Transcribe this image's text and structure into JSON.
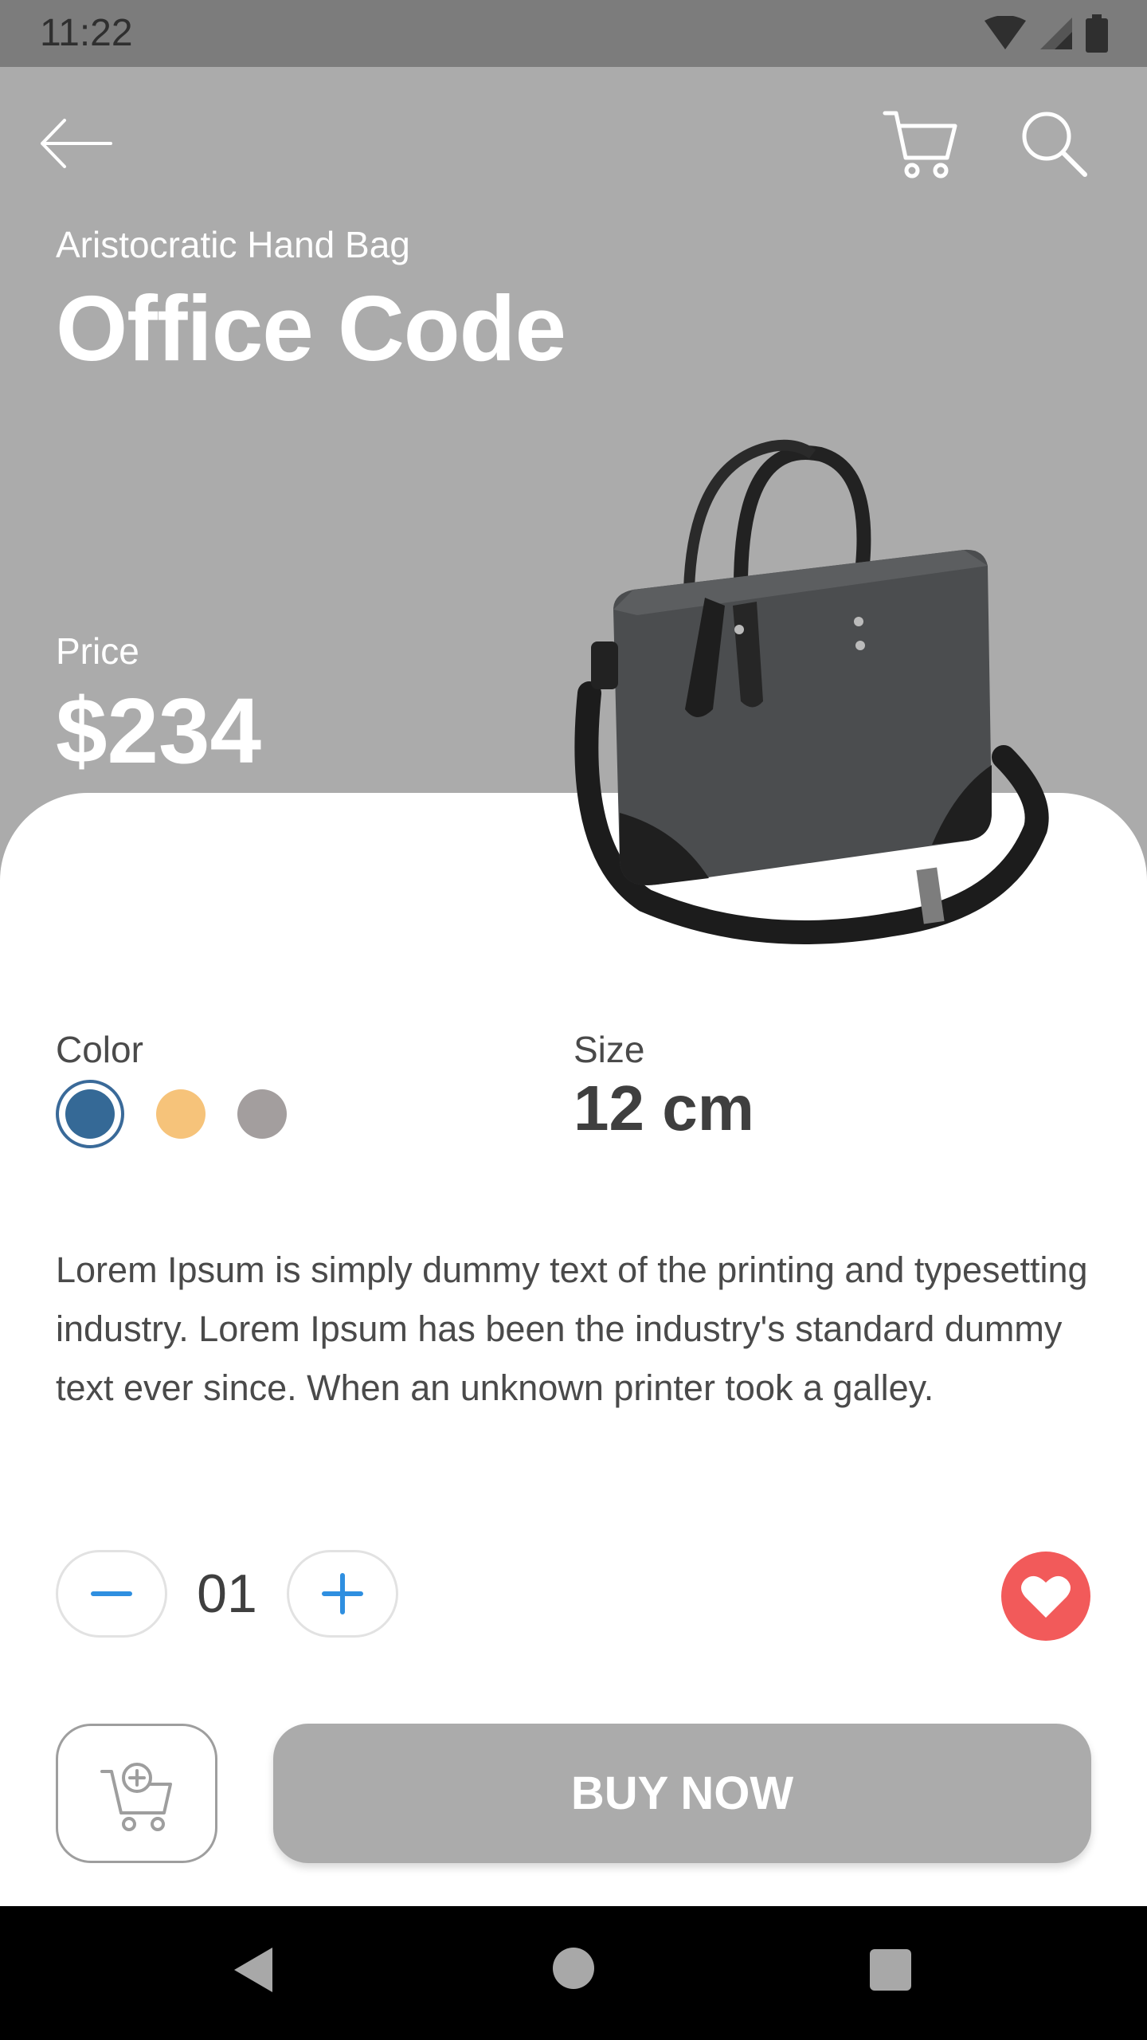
{
  "status_bar": {
    "time": "11:22"
  },
  "header": {
    "back_icon": "arrow-left-icon",
    "cart_icon": "cart-icon",
    "search_icon": "search-icon"
  },
  "product": {
    "subtitle": "Aristocratic Hand Bag",
    "title": "Office Code",
    "price_label": "Price",
    "price": "$234",
    "image": "handbag-image"
  },
  "options": {
    "color_label": "Color",
    "colors": [
      {
        "hex": "#356996",
        "selected": true
      },
      {
        "hex": "#f6c37a",
        "selected": false
      },
      {
        "hex": "#a39e9e",
        "selected": false
      }
    ],
    "size_label": "Size",
    "size": "12 cm"
  },
  "description": "Lorem Ipsum is simply dummy text of the printing and typesetting industry. Lorem Ipsum has been the industry's standard dummy text ever since. When an unknown printer took a galley.",
  "quantity": {
    "value": "01",
    "minus_icon": "minus-icon",
    "plus_icon": "plus-icon"
  },
  "favorite": {
    "icon": "heart-icon",
    "color": "#f25a5a"
  },
  "actions": {
    "add_to_cart_icon": "cart-plus-icon",
    "buy_label": "BUY NOW"
  },
  "colors": {
    "hero": "#ababab",
    "accent": "#2f8fe0",
    "text": "#4a4a4a"
  }
}
